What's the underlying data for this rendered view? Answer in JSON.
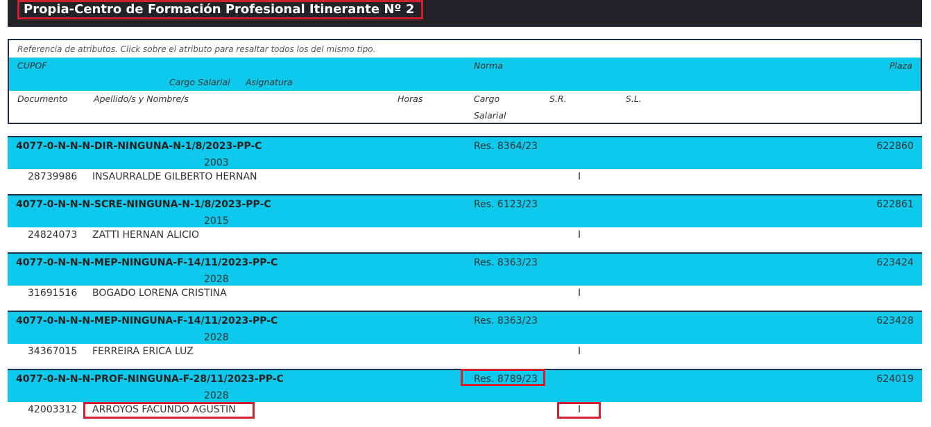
{
  "header": {
    "title": "Propia-Centro de Formación Profesional Itinerante Nº 2"
  },
  "legend": {
    "reference": "Referencia de atributos. Click sobre el atributo para resaltar todos los del mismo tipo.",
    "cupof": "CUPOF",
    "norma": "Norma",
    "plaza": "Plaza",
    "cargo_salarial": "Cargo Salarial",
    "asignatura": "Asignatura",
    "documento": "Documento",
    "apellido_nombre": "Apellido/s y Nombre/s",
    "horas": "Horas",
    "cargo": "Cargo",
    "salarial": "Salarial",
    "sr": "S.R.",
    "sl": "S.L."
  },
  "records": [
    {
      "cupof": "4077-0-N-N-N-DIR-NINGUNA-N-1/8/2023-PP-C",
      "norma": "Res. 8364/23",
      "plaza": "622860",
      "cargo": "2003",
      "documento": "28739986",
      "nombre": "INSAURRALDE GILBERTO HERNAN",
      "sr": "I"
    },
    {
      "cupof": "4077-0-N-N-N-SCRE-NINGUNA-N-1/8/2023-PP-C",
      "norma": "Res. 6123/23",
      "plaza": "622861",
      "cargo": "2015",
      "documento": "24824073",
      "nombre": "ZATTI HERNAN ALICIO",
      "sr": "I"
    },
    {
      "cupof": "4077-0-N-N-N-MEP-NINGUNA-F-14/11/2023-PP-C",
      "norma": "Res. 8363/23",
      "plaza": "623424",
      "cargo": "2028",
      "documento": "31691516",
      "nombre": "BOGADO LORENA CRISTINA",
      "sr": "I"
    },
    {
      "cupof": "4077-0-N-N-N-MEP-NINGUNA-F-14/11/2023-PP-C",
      "norma": "Res. 8363/23",
      "plaza": "623428",
      "cargo": "2028",
      "documento": "34367015",
      "nombre": "FERREIRA ERICA LUZ",
      "sr": "I"
    },
    {
      "cupof": "4077-0-N-N-N-PROF-NINGUNA-F-28/11/2023-PP-C",
      "norma": "Res. 8789/23",
      "plaza": "624019",
      "cargo": "2028",
      "documento": "42003312",
      "nombre": "ARROYOS FACUNDO AGUSTIN",
      "sr": "I"
    }
  ]
}
